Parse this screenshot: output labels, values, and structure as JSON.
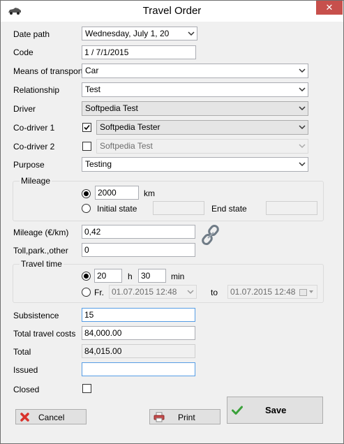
{
  "window": {
    "title": "Travel Order",
    "close_glyph": "✕"
  },
  "form": {
    "date_path": {
      "label": "Date path",
      "value": "Wednesday,    July     1, 20"
    },
    "code": {
      "label": "Code",
      "value": "1 / 7/1/2015"
    },
    "means_of_transport": {
      "label": "Means of transport",
      "value": "Car"
    },
    "relationship": {
      "label": "Relationship",
      "value": "Test"
    },
    "driver": {
      "label": "Driver",
      "value": "Softpedia Test"
    },
    "co_driver_1": {
      "label": "Co-driver 1",
      "checked": true,
      "value": "Softpedia Tester"
    },
    "co_driver_2": {
      "label": "Co-driver 2",
      "checked": false,
      "value": "Softpedia Test"
    },
    "purpose": {
      "label": "Purpose",
      "value": "Testing"
    }
  },
  "mileage": {
    "title": "Mileage",
    "km_value": "2000",
    "km_unit": "km",
    "initial_state_label": "Initial state",
    "initial_state_value": "",
    "end_state_label": "End state",
    "end_state_value": ""
  },
  "costs": {
    "mileage_rate": {
      "label": "Mileage (€/km)",
      "value": "0,42"
    },
    "toll": {
      "label": "Toll,park.,other",
      "value": "0"
    }
  },
  "travel_time": {
    "title": "Travel time",
    "hours": "20",
    "hours_unit": "h",
    "minutes": "30",
    "minutes_unit": "min",
    "from_label": "Fr.",
    "from_value": "01.07.2015  12:48",
    "to_label": "to",
    "to_value": "01.07.2015  12:48"
  },
  "totals": {
    "subsistence": {
      "label": "Subsistence",
      "value": "15"
    },
    "total_travel_costs": {
      "label": "Total travel costs",
      "value": "84,000.00"
    },
    "total": {
      "label": "Total",
      "value": "84,015.00"
    },
    "issued": {
      "label": "Issued",
      "value": ""
    },
    "closed": {
      "label": "Closed",
      "checked": false
    }
  },
  "buttons": {
    "cancel": "Cancel",
    "print": "Print",
    "save": "Save"
  },
  "colors": {
    "accent": "#569de5",
    "close": "#c7504c",
    "cancel_icon": "#d9322b",
    "save_icon": "#3aa13a"
  },
  "icons": [
    "car-icon",
    "close-icon",
    "chain-link-icon",
    "cancel-x-icon",
    "printer-icon",
    "checkmark-icon"
  ]
}
